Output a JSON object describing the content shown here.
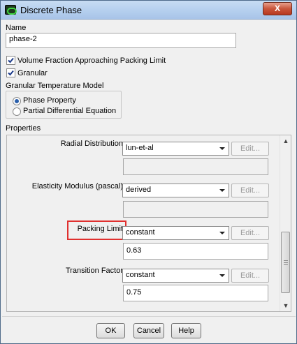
{
  "window": {
    "title": "Discrete Phase",
    "close_label": "X"
  },
  "name_section": {
    "label": "Name",
    "value": "phase-2"
  },
  "checkboxes": [
    {
      "label": "Volume Fraction Approaching Packing Limit",
      "checked": true
    },
    {
      "label": "Granular",
      "checked": true
    }
  ],
  "granular_model": {
    "title": "Granular Temperature Model",
    "options": [
      {
        "label": "Phase Property",
        "selected": true
      },
      {
        "label": "Partial Differential Equation",
        "selected": false
      }
    ]
  },
  "properties": {
    "title": "Properties",
    "rows": [
      {
        "label": "Radial Distribution",
        "dropdown": "lun-et-al",
        "edit": "Edit...",
        "value": ""
      },
      {
        "label": "Elasticity Modulus (pascal)",
        "dropdown": "derived",
        "edit": "Edit...",
        "value": ""
      },
      {
        "label": "Packing Limit",
        "dropdown": "constant",
        "edit": "Edit...",
        "value": "0.63"
      },
      {
        "label": "Transition Factor",
        "dropdown": "constant",
        "edit": "Edit...",
        "value": "0.75"
      }
    ]
  },
  "buttons": {
    "ok": "OK",
    "cancel": "Cancel",
    "help": "Help"
  },
  "colors": {
    "highlight": "#e0302f",
    "titlebar": "#b5cfee"
  }
}
